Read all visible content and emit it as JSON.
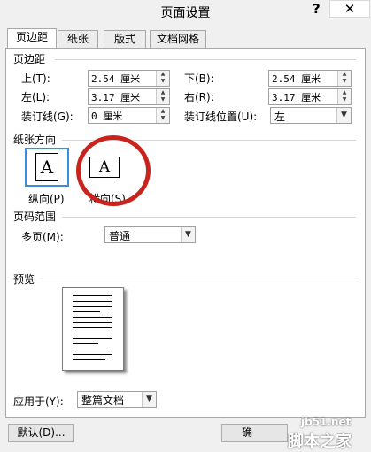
{
  "window": {
    "title": "页面设置",
    "help": "?",
    "close": "✕"
  },
  "tabs": [
    {
      "label": "页边距"
    },
    {
      "label": "纸张"
    },
    {
      "label": "版式"
    },
    {
      "label": "文档网格"
    }
  ],
  "margins": {
    "section": "页边距",
    "top_label": "上(T):",
    "top_value": "2.54 厘米",
    "bottom_label": "下(B):",
    "bottom_value": "2.54 厘米",
    "left_label": "左(L):",
    "left_value": "3.17 厘米",
    "right_label": "右(R):",
    "right_value": "3.17 厘米",
    "gutter_label": "装订线(G):",
    "gutter_value": "0 厘米",
    "gutter_pos_label": "装订线位置(U):",
    "gutter_pos_value": "左"
  },
  "orientation": {
    "section": "纸张方向",
    "portrait_label": "纵向(P)",
    "landscape_label": "横向(S)",
    "letter": "A"
  },
  "pages": {
    "section": "页码范围",
    "multiple_label": "多页(M):",
    "multiple_value": "普通"
  },
  "preview": {
    "section": "预览"
  },
  "apply": {
    "label": "应用于(Y):",
    "value": "整篇文档"
  },
  "footer": {
    "default_button": "默认(D)...",
    "ok_button": "确"
  },
  "watermark": {
    "site": "jb51.net",
    "brand": "脚本之家"
  },
  "colors": {
    "highlight_circle": "#c8231d",
    "selection_border": "#3b8fd8"
  }
}
